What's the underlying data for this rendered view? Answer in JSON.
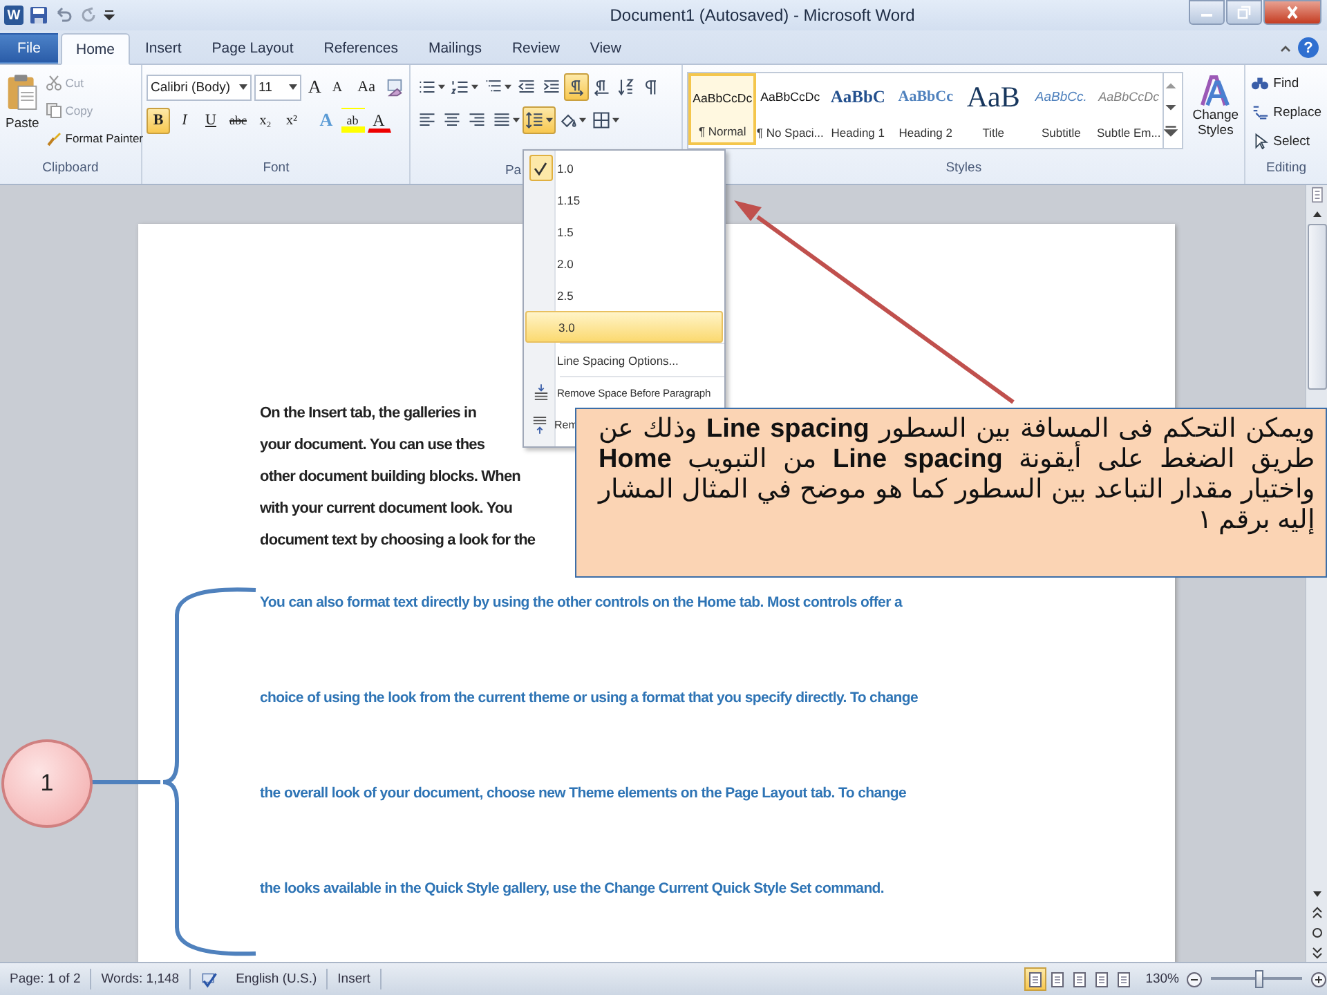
{
  "window": {
    "app_logo": "W",
    "title": "Document1 (Autosaved) - Microsoft Word",
    "help": "?"
  },
  "tabs": [
    {
      "label": "File",
      "kind": "file",
      "selected": false
    },
    {
      "label": "Home",
      "kind": "tab",
      "selected": true
    },
    {
      "label": "Insert",
      "kind": "tab",
      "selected": false
    },
    {
      "label": "Page Layout",
      "kind": "tab",
      "selected": false
    },
    {
      "label": "References",
      "kind": "tab",
      "selected": false
    },
    {
      "label": "Mailings",
      "kind": "tab",
      "selected": false
    },
    {
      "label": "Review",
      "kind": "tab",
      "selected": false
    },
    {
      "label": "View",
      "kind": "tab",
      "selected": false
    }
  ],
  "clipboard": {
    "paste": "Paste",
    "items": [
      {
        "label": "Cut",
        "kind": "cut",
        "disabled": true
      },
      {
        "label": "Copy",
        "kind": "copy",
        "disabled": true
      },
      {
        "label": "Format Painter",
        "kind": "painter",
        "disabled": false
      }
    ],
    "label": "Clipboard"
  },
  "font": {
    "font_name": "Calibri (Body)",
    "font_size": "11",
    "size_buttons": [
      {
        "label": "A",
        "kind": "grow"
      },
      {
        "label": "A",
        "kind": "shrink"
      },
      {
        "label": "Aa",
        "kind": "case"
      }
    ],
    "format_buttons": [
      {
        "label": "B",
        "kind": "bold",
        "selected": true
      },
      {
        "label": "I",
        "kind": "italic",
        "selected": false
      },
      {
        "label": "U",
        "kind": "underline",
        "selected": false
      },
      {
        "label": "abc",
        "kind": "strike",
        "selected": false
      },
      {
        "label": "x₂",
        "kind": "sub",
        "selected": false
      },
      {
        "label": "x²",
        "kind": "sup",
        "selected": false
      },
      {
        "label": "A",
        "kind": "effects",
        "selected": false
      },
      {
        "label": "ab",
        "kind": "highlight",
        "selected": false
      },
      {
        "label": "A",
        "kind": "color",
        "selected": false
      }
    ],
    "label": "Font"
  },
  "paragraph": {
    "row_1": [
      {
        "kind": "bullets",
        "selected": false
      },
      {
        "kind": "numbering",
        "selected": false
      },
      {
        "kind": "multilevel",
        "selected": false
      },
      {
        "kind": "decrease-indent",
        "selected": false
      },
      {
        "kind": "increase-indent",
        "selected": false
      },
      {
        "kind": "ltr",
        "selected": true
      },
      {
        "kind": "rtl",
        "selected": false
      },
      {
        "kind": "sort",
        "selected": false
      },
      {
        "kind": "pilcrow",
        "selected": false
      }
    ],
    "row_2": [
      {
        "kind": "align-left",
        "selected": false
      },
      {
        "kind": "center",
        "selected": false
      },
      {
        "kind": "align-right",
        "selected": false
      },
      {
        "kind": "justify",
        "selected": false
      },
      {
        "kind": "line-spacing",
        "selected": true
      },
      {
        "kind": "shading",
        "selected": false
      },
      {
        "kind": "borders",
        "selected": false
      }
    ],
    "label": "Pa"
  },
  "styles": {
    "items": [
      {
        "sample": "AaBbCcDc",
        "label": "¶ Normal",
        "kind": "normal",
        "selected": true
      },
      {
        "sample": "AaBbCcDc",
        "label": "¶ No Spaci...",
        "kind": "normal",
        "selected": false
      },
      {
        "sample": "AaBbC",
        "label": "Heading 1",
        "kind": "heading1",
        "selected": false
      },
      {
        "sample": "AaBbCc",
        "label": "Heading 2",
        "kind": "heading2",
        "selected": false
      },
      {
        "sample": "AaB",
        "label": "Title",
        "kind": "title",
        "selected": false
      },
      {
        "sample": "AaBbCc.",
        "label": "Subtitle",
        "kind": "subtitle",
        "selected": false
      },
      {
        "sample": "AaBbCcDc",
        "label": "Subtle Em...",
        "kind": "subtle",
        "selected": false
      }
    ],
    "change_styles": "Change Styles",
    "label": "Styles"
  },
  "editing": {
    "items": [
      {
        "label": "Find",
        "kind": "find"
      },
      {
        "label": "Replace",
        "kind": "replace"
      },
      {
        "label": "Select",
        "kind": "select"
      }
    ],
    "label": "Editing"
  },
  "document": {
    "paragraph_1": [
      "On the Insert tab, the galleries in",
      "your document. You can use thes",
      "other document building blocks. When",
      "with your current document look. You",
      "document text by choosing a look for the"
    ],
    "paragraph_2": [
      "You can also format text directly by using the other controls on the Home tab. Most controls offer a",
      "choice of using the look from the current theme or using a format that you specify directly. To change",
      "the overall look of your document, choose new Theme elements on the Page Layout tab. To change",
      "the looks available in the Quick Style gallery, use the Change Current Quick Style Set command."
    ]
  },
  "line_spacing_menu": [
    {
      "label": "1.0",
      "kind": "value",
      "checked": true,
      "selected": false
    },
    {
      "label": "1.15",
      "kind": "value",
      "checked": false,
      "selected": false
    },
    {
      "label": "1.5",
      "kind": "value",
      "checked": false,
      "selected": false
    },
    {
      "label": "2.0",
      "kind": "value",
      "checked": false,
      "selected": false
    },
    {
      "label": "2.5",
      "kind": "value",
      "checked": false,
      "selected": false
    },
    {
      "label": "3.0",
      "kind": "value",
      "checked": false,
      "selected": true
    },
    {
      "label": "Line Spacing Options...",
      "kind": "option"
    },
    {
      "label": "Remove Space Before Paragraph",
      "kind": "remove-before"
    },
    {
      "label": "Rem",
      "kind": "remove-after"
    }
  ],
  "callout": {
    "text": "ويمكن التحكم فى المسافة بين السطور **Line spacing** وذلك عن طريق الضغط على أيقونة **Line spacing** من التبويب **Home** واختيار مقدار التباعد بين السطور كما هو موضح في المثال المشار إليه برقم ١"
  },
  "marker": {
    "label": "1"
  },
  "status_bar": {
    "page": "Page: 1 of 2",
    "words": "Words: 1,148",
    "language": "English (U.S.)",
    "mode": "Insert",
    "views": [
      {
        "selected": true
      },
      {
        "selected": false
      },
      {
        "selected": false
      },
      {
        "selected": false
      },
      {
        "selected": false
      }
    ],
    "zoom": "130%",
    "zoom_slider": {
      "level": 0.53
    }
  }
}
